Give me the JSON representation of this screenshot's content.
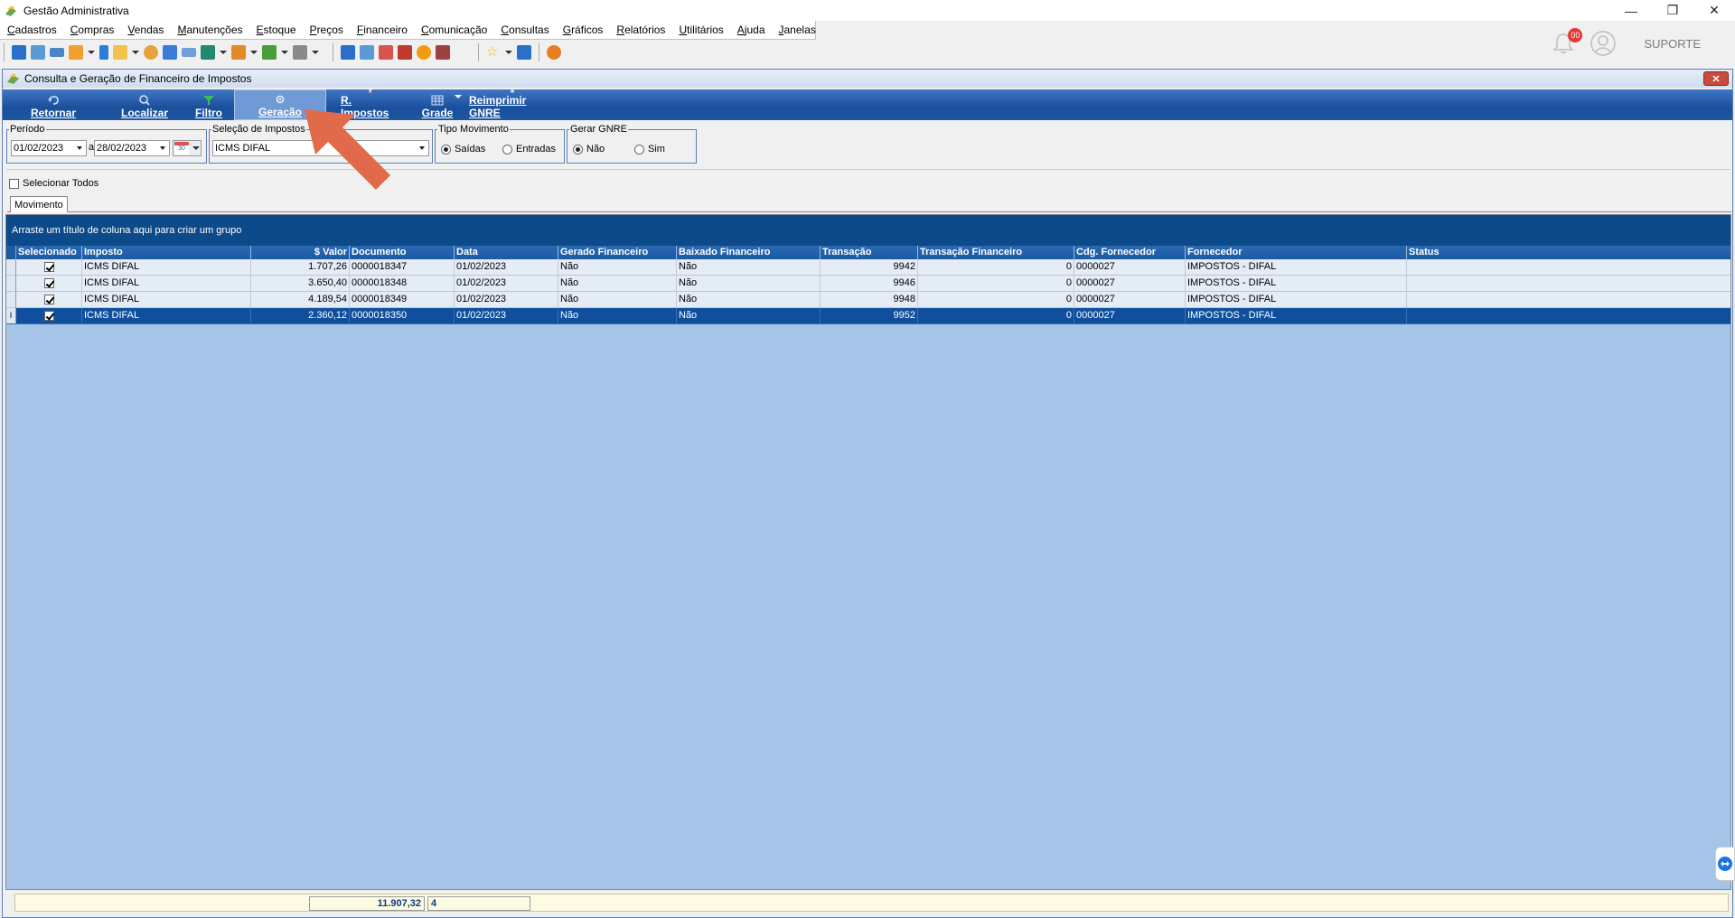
{
  "window": {
    "title": "Gestão Administrativa"
  },
  "menu": [
    "Cadastros",
    "Compras",
    "Vendas",
    "Manutenções",
    "Estoque",
    "Preços",
    "Financeiro",
    "Comunicação",
    "Consultas",
    "Gráficos",
    "Relatórios",
    "Utilitários",
    "Ajuda",
    "Janelas"
  ],
  "header": {
    "notification_count": "00",
    "user_label": "SUPORTE"
  },
  "child": {
    "title": "Consulta e Geração de Financeiro de Impostos",
    "ribbon": {
      "retornar": "Retornar",
      "localizar": "Localizar",
      "filtro": "Filtro",
      "geracao": "Geração",
      "r_impostos": "R. Impostos",
      "grade": "Grade",
      "reimprimir": "Reimprimir GNRE"
    },
    "filters": {
      "periodo_label": "Período",
      "date_from": "01/02/2023",
      "a": "a",
      "date_to": "28/02/2023",
      "calendar_num": "30",
      "impostos_label": "Seleção de Impostos",
      "imposto_value": "ICMS DIFAL",
      "tipo_label": "Tipo Movimento",
      "saidas": "Saídas",
      "entradas": "Entradas",
      "gnre_label": "Gerar GNRE",
      "nao": "Não",
      "sim": "Sim"
    },
    "select_all": "Selecionar Todos",
    "tab": "Movimento",
    "group_hint": "Arraste um título de coluna aqui para criar um grupo"
  },
  "grid": {
    "columns": [
      "Selecionado",
      "Imposto",
      "$ Valor",
      "Documento",
      "Data",
      "Gerado Financeiro",
      "Baixado Financeiro",
      "Transação",
      "Transação Financeiro",
      "Cdg. Fornecedor",
      "Fornecedor",
      "Status"
    ],
    "rows": [
      {
        "imposto": "ICMS DIFAL",
        "valor": "1.707,26",
        "documento": "0000018347",
        "data": "01/02/2023",
        "gerado": "Não",
        "baixado": "Não",
        "transacao": "9942",
        "transacao_fin": "0",
        "cdg": "0000027",
        "fornecedor": "IMPOSTOS - DIFAL",
        "status": ""
      },
      {
        "imposto": "ICMS DIFAL",
        "valor": "3.650,40",
        "documento": "0000018348",
        "data": "01/02/2023",
        "gerado": "Não",
        "baixado": "Não",
        "transacao": "9946",
        "transacao_fin": "0",
        "cdg": "0000027",
        "fornecedor": "IMPOSTOS - DIFAL",
        "status": ""
      },
      {
        "imposto": "ICMS DIFAL",
        "valor": "4.189,54",
        "documento": "0000018349",
        "data": "01/02/2023",
        "gerado": "Não",
        "baixado": "Não",
        "transacao": "9948",
        "transacao_fin": "0",
        "cdg": "0000027",
        "fornecedor": "IMPOSTOS - DIFAL",
        "status": ""
      },
      {
        "imposto": "ICMS DIFAL",
        "valor": "2.360,12",
        "documento": "0000018350",
        "data": "01/02/2023",
        "gerado": "Não",
        "baixado": "Não",
        "transacao": "9952",
        "transacao_fin": "0",
        "cdg": "0000027",
        "fornecedor": "IMPOSTOS - DIFAL",
        "status": ""
      }
    ],
    "total_valor": "11.907,32",
    "total_count": "4"
  },
  "colors": {
    "ribbon": "#1b4f9c",
    "grid_bg": "#a6c4e8",
    "selected_row": "#0f4f9e",
    "arrow": "#e06a4a"
  }
}
